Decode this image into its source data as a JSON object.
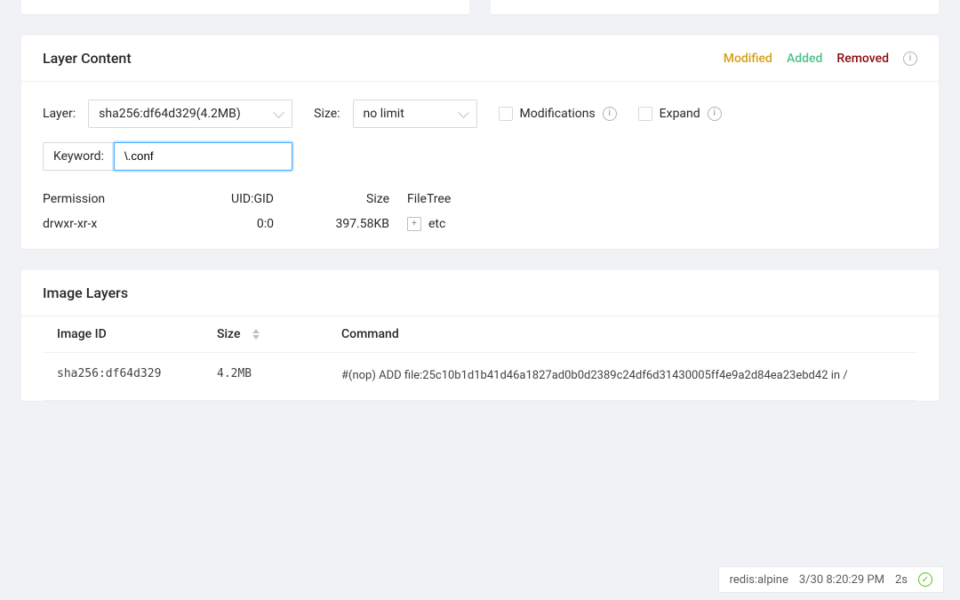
{
  "layerContent": {
    "title": "Layer Content",
    "legend": {
      "modified": "Modified",
      "added": "Added",
      "removed": "Removed"
    },
    "filters": {
      "layerLabel": "Layer:",
      "layerSelected": "sha256:df64d329(4.2MB)",
      "sizeLabel": "Size:",
      "sizeSelected": "no limit",
      "modificationsLabel": "Modifications",
      "expandLabel": "Expand",
      "keywordLabel": "Keyword:",
      "keywordValue": "\\.conf"
    },
    "columns": {
      "permission": "Permission",
      "uidgid": "UID:GID",
      "size": "Size",
      "filetree": "FileTree"
    },
    "rows": [
      {
        "permission": "drwxr-xr-x",
        "uidgid": "0:0",
        "size": "397.58KB",
        "name": "etc"
      }
    ]
  },
  "imageLayers": {
    "title": "Image Layers",
    "columns": {
      "id": "Image ID",
      "size": "Size",
      "command": "Command"
    },
    "rows": [
      {
        "id": "sha256:df64d329",
        "size": "4.2MB",
        "command": "#(nop) ADD file:25c10b1d1b41d46a1827ad0b0d2389c24df6d31430005ff4e9a2d84ea23ebd42 in /"
      }
    ]
  },
  "status": {
    "image": "redis:alpine",
    "time": "3/30 8:20:29 PM",
    "duration": "2s"
  }
}
